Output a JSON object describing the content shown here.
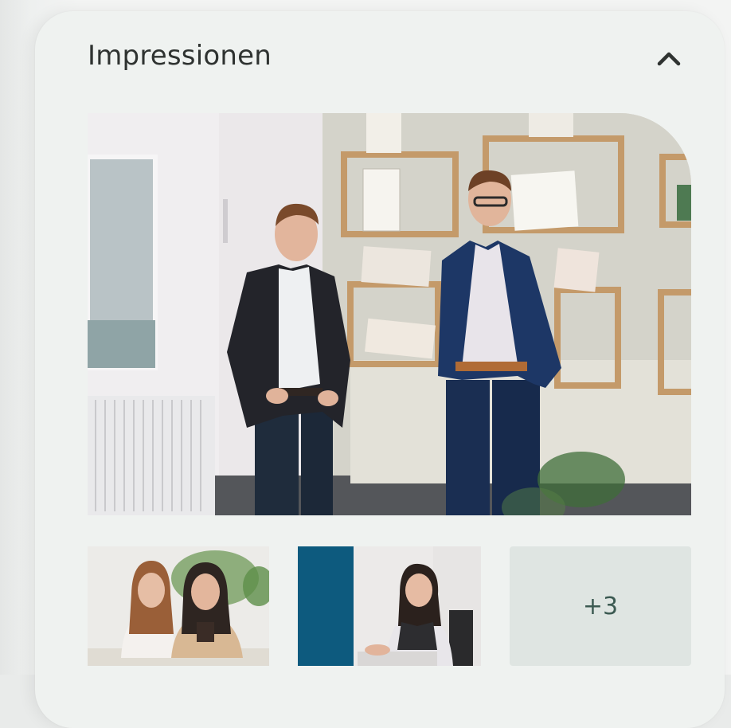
{
  "gallery": {
    "title": "Impressionen",
    "collapse_icon": "chevron-up-icon",
    "hero_image": "two-men-standing-in-office",
    "thumbnails": [
      {
        "image": "two-women-at-desk"
      },
      {
        "image": "woman-at-computer-desk"
      }
    ],
    "more_label": "+3"
  },
  "colors": {
    "card_background": "#eff2f0",
    "title_text": "#2f3331",
    "more_tile_background": "#dfe5e2",
    "more_tile_text": "#3c5a52"
  }
}
